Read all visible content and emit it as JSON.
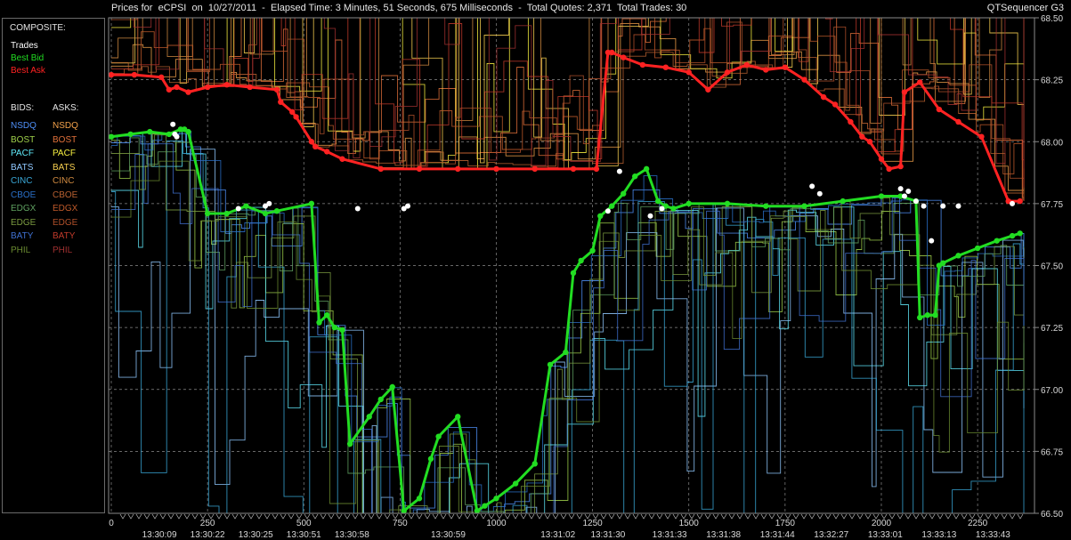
{
  "header": {
    "title": "Prices for  eCPSI  on  10/27/2011  -  Elapsed Time: 3 Minutes, 51 Seconds, 675 Milliseconds  -  Total Quotes: 2,371  Total Trades: 30",
    "app": "QTSequencer G3"
  },
  "legend": {
    "composite_title": "COMPOSITE:",
    "composite": [
      {
        "label": "Trades",
        "color": "#ffffff"
      },
      {
        "label": "Best Bid",
        "color": "#22dd22"
      },
      {
        "label": "Best Ask",
        "color": "#ff2222"
      }
    ],
    "bids_title": "BIDS:",
    "asks_title": "ASKS:",
    "exchanges": [
      {
        "bid": "NSDQ",
        "ask": "NSDQ",
        "bid_color": "#4f8ff7",
        "ask_color": "#f2a14a"
      },
      {
        "bid": "BOST",
        "ask": "BOST",
        "bid_color": "#9fd04a",
        "ask_color": "#e0703a"
      },
      {
        "bid": "PACF",
        "ask": "PACF",
        "bid_color": "#5fe8f8",
        "ask_color": "#f7f040"
      },
      {
        "bid": "BATS",
        "ask": "BATS",
        "bid_color": "#8fc8ff",
        "ask_color": "#f8d050"
      },
      {
        "bid": "CINC",
        "ask": "CINC",
        "bid_color": "#3aa8d8",
        "ask_color": "#d08a40"
      },
      {
        "bid": "CBOE",
        "ask": "CBOE",
        "bid_color": "#2a70c8",
        "ask_color": "#b86030"
      },
      {
        "bid": "EDGX",
        "ask": "EDGX",
        "bid_color": "#5fa060",
        "ask_color": "#c05a2a"
      },
      {
        "bid": "EDGE",
        "ask": "EDGE",
        "bid_color": "#7a9a40",
        "ask_color": "#b0502a"
      },
      {
        "bid": "BATY",
        "ask": "BATY",
        "bid_color": "#3f70d0",
        "ask_color": "#c03a2a"
      },
      {
        "bid": "PHIL",
        "ask": "PHIL",
        "bid_color": "#6a8a30",
        "ask_color": "#a03030"
      }
    ]
  },
  "chart_data": {
    "type": "line",
    "title": "Prices for  eCPSI  on  10/27/2011",
    "xlabel": "",
    "ylabel": "",
    "xlim": [
      0,
      2370
    ],
    "ylim": [
      66.5,
      68.5
    ],
    "grid": true,
    "x_ticks": [
      "0",
      "250",
      "500",
      "750",
      "1000",
      "1250",
      "1500",
      "1750",
      "2000",
      "2250"
    ],
    "x_tick_values": [
      0,
      250,
      500,
      750,
      1000,
      1250,
      1500,
      1750,
      2000,
      2250
    ],
    "time_labels": [
      {
        "x": 125,
        "label": "13:30:09"
      },
      {
        "x": 250,
        "label": "13:30:22"
      },
      {
        "x": 375,
        "label": "13:30:25"
      },
      {
        "x": 500,
        "label": "13:30:51"
      },
      {
        "x": 625,
        "label": "13:30:58"
      },
      {
        "x": 875,
        "label": "13:30:59"
      },
      {
        "x": 1160,
        "label": "13:31:02"
      },
      {
        "x": 1290,
        "label": "13:31:30"
      },
      {
        "x": 1450,
        "label": "13:31:33"
      },
      {
        "x": 1590,
        "label": "13:31:38"
      },
      {
        "x": 1730,
        "label": "13:31:44"
      },
      {
        "x": 1870,
        "label": "13:32:27"
      },
      {
        "x": 2010,
        "label": "13:33:01"
      },
      {
        "x": 2150,
        "label": "13:33:13"
      },
      {
        "x": 2290,
        "label": "13:33:43"
      }
    ],
    "y_ticks": [
      "66.50",
      "66.75",
      "67.00",
      "67.25",
      "67.50",
      "67.75",
      "68.00",
      "68.25",
      "68.50"
    ],
    "y_tick_values": [
      66.5,
      66.75,
      67.0,
      67.25,
      67.5,
      67.75,
      68.0,
      68.25,
      68.5
    ],
    "series": [
      {
        "name": "Best Bid",
        "color": "#22dd22",
        "x": [
          0,
          50,
          100,
          150,
          180,
          190,
          200,
          250,
          300,
          350,
          400,
          430,
          520,
          540,
          560,
          580,
          600,
          620,
          670,
          700,
          730,
          760,
          800,
          830,
          850,
          900,
          950,
          970,
          1000,
          1050,
          1100,
          1140,
          1180,
          1200,
          1220,
          1250,
          1270,
          1300,
          1330,
          1360,
          1390,
          1420,
          1440,
          1460,
          1500,
          1600,
          1700,
          1800,
          1900,
          2000,
          2050,
          2090,
          2100,
          2120,
          2140,
          2150,
          2160,
          2200,
          2250,
          2300,
          2340,
          2360
        ],
        "y": [
          68.02,
          68.03,
          68.04,
          68.03,
          68.05,
          68.05,
          68.04,
          67.71,
          67.71,
          67.74,
          67.71,
          67.72,
          67.75,
          67.27,
          67.3,
          67.25,
          67.24,
          66.78,
          66.89,
          66.96,
          67.01,
          66.51,
          66.56,
          66.72,
          66.81,
          66.89,
          66.51,
          66.53,
          66.56,
          66.62,
          66.7,
          67.1,
          67.15,
          67.47,
          67.52,
          67.56,
          67.7,
          67.74,
          67.79,
          67.86,
          67.89,
          67.76,
          67.74,
          67.73,
          67.75,
          67.75,
          67.74,
          67.74,
          67.76,
          67.78,
          67.78,
          67.76,
          67.29,
          67.3,
          67.3,
          67.5,
          67.51,
          67.54,
          67.57,
          67.6,
          67.62,
          67.63
        ]
      },
      {
        "name": "Best Ask",
        "color": "#ff2222",
        "x": [
          0,
          60,
          130,
          150,
          170,
          200,
          250,
          300,
          360,
          430,
          440,
          470,
          480,
          520,
          530,
          560,
          600,
          700,
          800,
          900,
          1000,
          1100,
          1200,
          1260,
          1290,
          1300,
          1330,
          1380,
          1440,
          1500,
          1550,
          1600,
          1650,
          1700,
          1750,
          1800,
          1850,
          1880,
          1920,
          1950,
          1970,
          2000,
          2020,
          2050,
          2060,
          2100,
          2150,
          2200,
          2260,
          2330,
          2360
        ],
        "y": [
          68.27,
          68.27,
          68.26,
          68.21,
          68.22,
          68.2,
          68.22,
          68.23,
          68.22,
          68.21,
          68.16,
          68.12,
          68.1,
          68.0,
          67.98,
          67.96,
          67.93,
          67.89,
          67.89,
          67.89,
          67.89,
          67.89,
          67.89,
          67.89,
          68.36,
          68.36,
          68.34,
          68.31,
          68.3,
          68.28,
          68.21,
          68.28,
          68.31,
          68.29,
          68.3,
          68.25,
          68.18,
          68.15,
          68.08,
          68.02,
          68.0,
          67.93,
          67.89,
          67.9,
          68.2,
          68.24,
          68.13,
          68.08,
          68.02,
          67.76,
          67.76
        ]
      },
      {
        "name": "Trades",
        "color": "#ffffff",
        "x": [
          160,
          165,
          170,
          330,
          400,
          410,
          640,
          760,
          770,
          1290,
          1320,
          1400,
          1430,
          1820,
          1840,
          2050,
          2060,
          2070,
          2090,
          2110,
          2130,
          2160,
          2200,
          2340
        ],
        "y": [
          68.07,
          68.03,
          68.02,
          67.73,
          67.74,
          67.75,
          67.73,
          67.73,
          67.74,
          67.72,
          67.88,
          67.7,
          67.73,
          67.82,
          67.79,
          67.81,
          67.78,
          67.8,
          67.76,
          67.74,
          67.6,
          67.74,
          67.74,
          67.75
        ]
      }
    ]
  }
}
